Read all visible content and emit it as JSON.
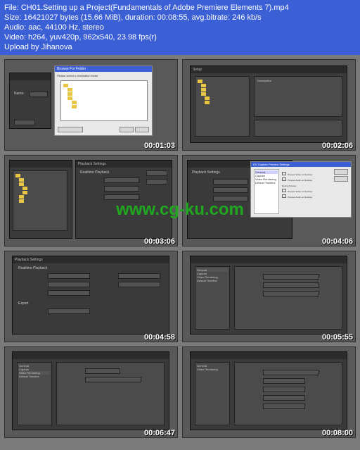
{
  "header": {
    "file": "File: CH01.Setting up a Project(Fundamentals of Adobe Premiere Elements 7).mp4",
    "size": "Size: 16421027 bytes (15.66 MiB), duration: 00:08:55, avg.bitrate: 246 kb/s",
    "audio": "Audio: aac, 44100 Hz, stereo",
    "video": "Video: h264, yuv420p, 962x540, 23.98 fps(r)",
    "upload": "Upload by Jihanova"
  },
  "thumbs": [
    {
      "ts": "00:01:03",
      "browse_title": "Browse For Folder",
      "browse_hint": "Please select a destination folder"
    },
    {
      "ts": "00:02:06",
      "setup": "Setup"
    },
    {
      "ts": "00:03:06",
      "panel": "Playback Settings",
      "realtime": "Realtime Playback"
    },
    {
      "ts": "00:04:06",
      "panel": "DV Capture Preview Settings",
      "general": "General",
      "capture": "Capture",
      "rendering": "Video Rendering",
      "timeline": "Default Timeline",
      "preview_video": "Preview Video on Desktop",
      "preview_audio": "Preview Audio on Desktop",
      "during": "During Preview",
      "capture_preview_video": "Preview Video on Desktop",
      "capture_preview_audio": "Preview Audio on Desktop"
    },
    {
      "ts": "00:04:58",
      "panel": "Playback Settings",
      "realtime": "Realtime Playback",
      "export": "Export"
    },
    {
      "ts": "00:05:55",
      "general": "General",
      "capture": "Capture",
      "rendering": "Video Rendering",
      "timeline": "Default Timeline"
    },
    {
      "ts": "00:06:47",
      "general": "General",
      "capture": "Capture",
      "rendering": "Video Rendering",
      "timeline": "Default Timeline"
    },
    {
      "ts": "00:08:00",
      "general": "General",
      "rendering": "Video Rendering"
    }
  ],
  "watermark": "www.cg-ku.com"
}
